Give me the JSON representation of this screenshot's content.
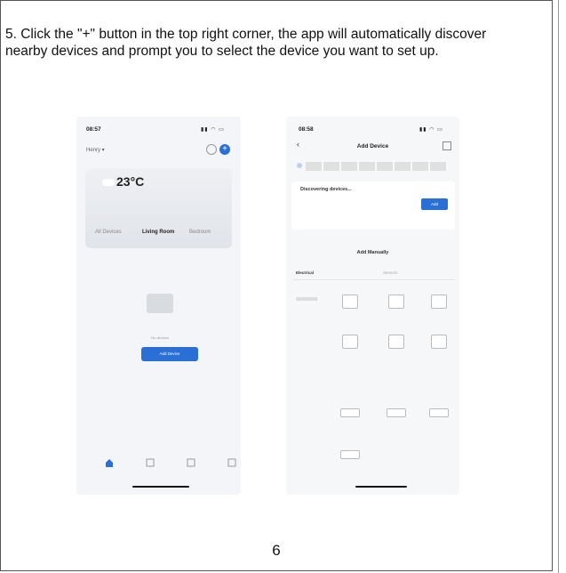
{
  "instruction": "5. Click the \"+\" button in the top right corner, the app will automatically discover nearby devices and prompt you to select the device you want to set up.",
  "page_number": "6",
  "phone1": {
    "time": "08:57",
    "home_name": "Henry",
    "temperature": "23°C",
    "tabs": [
      "All Devices",
      "Living Room",
      "Bedroom"
    ],
    "selected_tab": "Living Room",
    "no_devices": "No devices",
    "add_device_button": "Add Device"
  },
  "phone2": {
    "time": "08:58",
    "title": "Add Device",
    "discovering": "Discovering devices...",
    "add_button": "Add",
    "add_manually": "Add Manually",
    "category_tabs": [
      "Electrical",
      "Sensors"
    ]
  }
}
